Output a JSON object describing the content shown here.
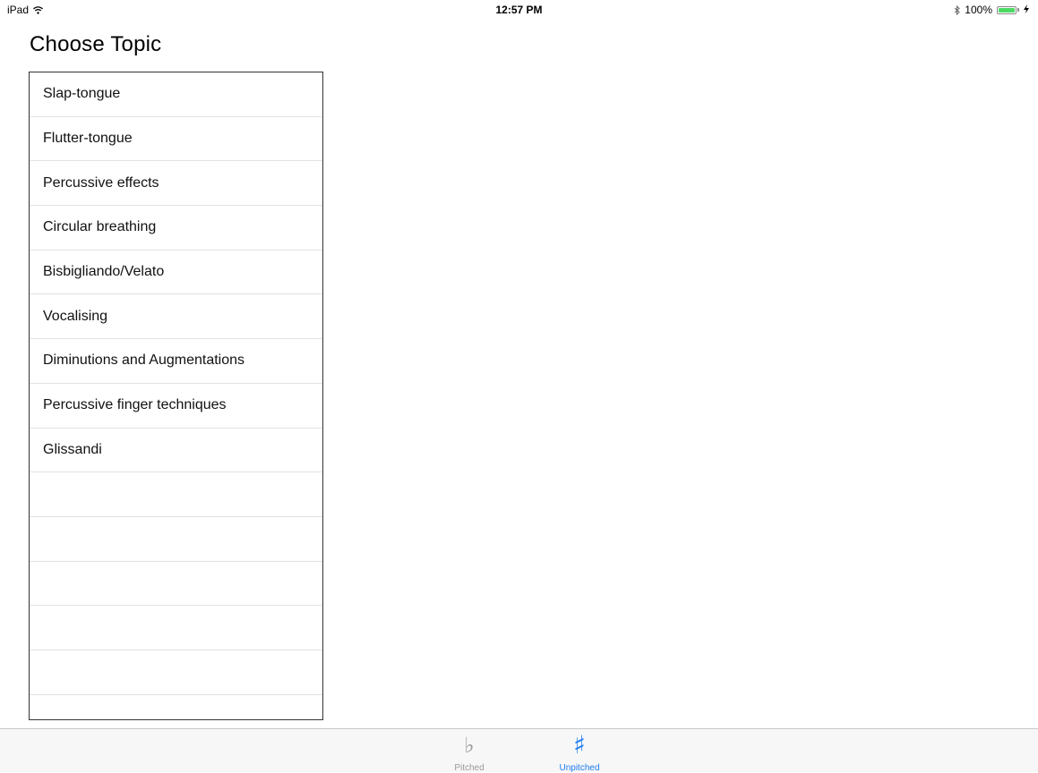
{
  "status_bar": {
    "device": "iPad",
    "time": "12:57 PM",
    "battery_percent": "100%",
    "battery_level": 1.0,
    "wifi_icon": "wifi-icon",
    "bluetooth_icon": "bluetooth-icon",
    "charging_icon": "charging-icon"
  },
  "page": {
    "title": "Choose Topic"
  },
  "topics": [
    "Slap-tongue",
    "Flutter-tongue",
    "Percussive effects",
    "Circular breathing",
    "Bisbigliando/Velato",
    "Vocalising",
    "Diminutions and Augmentations",
    "Percussive finger techniques",
    "Glissandi"
  ],
  "tabs": [
    {
      "label": "Pitched",
      "icon": "flat",
      "glyph": "♭",
      "selected": false
    },
    {
      "label": "Unpitched",
      "icon": "sharp",
      "glyph": "♯",
      "selected": true
    }
  ],
  "colors": {
    "accent": "#1e7cf2",
    "inactive": "#9a9a9a",
    "battery": "#4cd964"
  }
}
